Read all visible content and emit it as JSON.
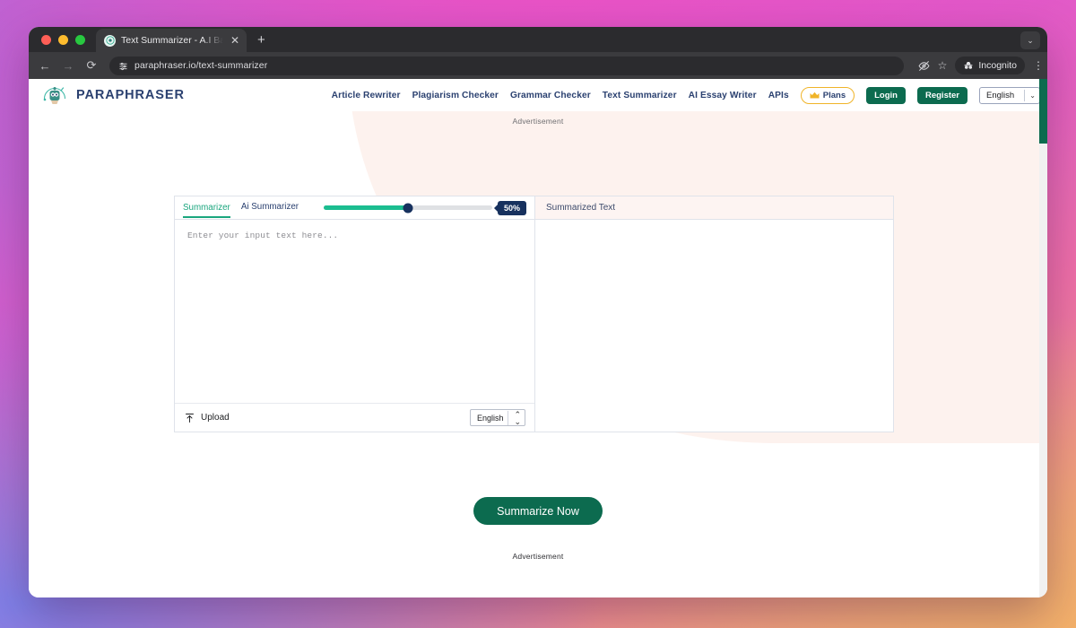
{
  "browser": {
    "tab": {
      "title": "Text Summarizer - A.I Based ",
      "favicon": "robot-icon",
      "close": "✕"
    },
    "new_tab_label": "+",
    "window_chevron": "⌄",
    "nav": {
      "back": "←",
      "forward": "→",
      "reload": "⟳"
    },
    "omnibox": {
      "url": "paraphraser.io/text-summarizer",
      "site_settings_icon": "tune-icon"
    },
    "right_icons": {
      "extension": "eye-slash-icon",
      "bookmark": "☆",
      "menu": "⋮"
    },
    "incognito_label": "Incognito"
  },
  "site": {
    "brand": "PARAPHRASER",
    "nav_links": [
      "Article Rewriter",
      "Plagiarism Checker",
      "Grammar Checker",
      "Text Summarizer",
      "AI Essay Writer",
      "APIs"
    ],
    "plans_label": "Plans",
    "plans_icon": "crown-icon",
    "login_label": "Login",
    "register_label": "Register",
    "language": "English",
    "language_caret": "⌄"
  },
  "ads": {
    "top_label": "Advertisement",
    "bottom_label": "Advertisement"
  },
  "tool": {
    "tabs": [
      {
        "label": "Summarizer",
        "active": true
      },
      {
        "label": "Ai Summarizer",
        "active": false
      }
    ],
    "slider": {
      "value": 50,
      "display": "50%",
      "fill_color": "#1bbd90",
      "track_color": "#dfe1e4",
      "thumb_color": "#17315e"
    },
    "input": {
      "placeholder": "Enter your input text here...",
      "value": ""
    },
    "upload_label": "Upload",
    "upload_icon": "upload-icon",
    "input_language": "English",
    "output_title": "Summarized Text",
    "output_value": ""
  },
  "cta": {
    "label": "Summarize Now",
    "color": "#0c6b4f"
  }
}
